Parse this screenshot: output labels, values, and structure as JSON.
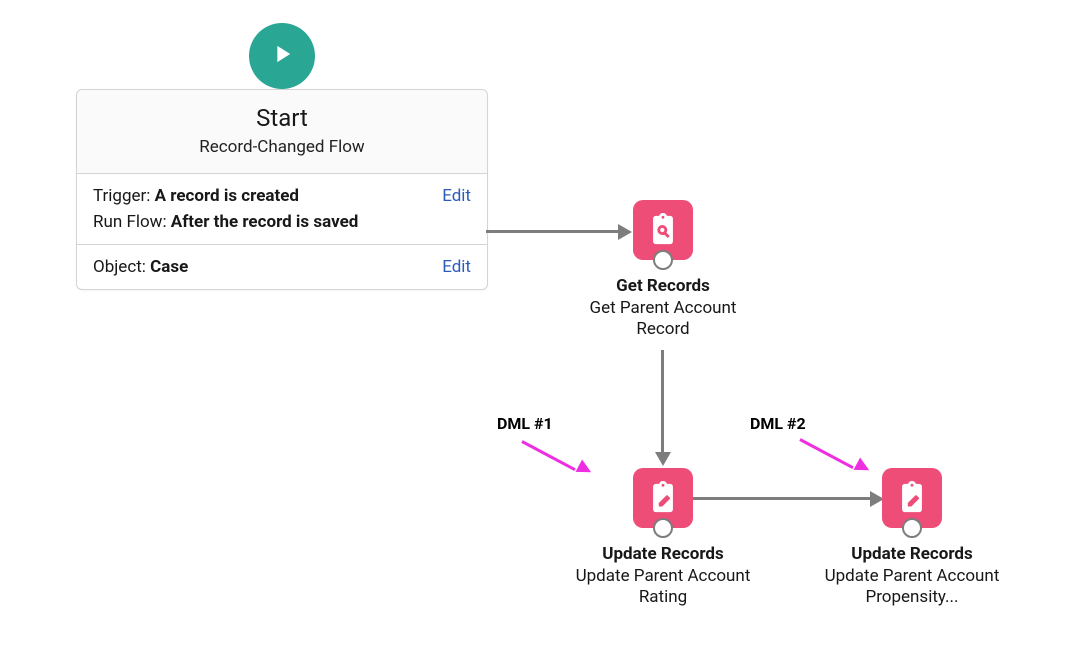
{
  "start": {
    "title": "Start",
    "subtitle": "Record-Changed Flow",
    "trigger_label": "Trigger: ",
    "trigger_value": "A record is created",
    "runflow_label": "Run Flow: ",
    "runflow_value": "After the record is saved",
    "object_label": "Object: ",
    "object_value": "Case",
    "edit_label": "Edit"
  },
  "nodes": {
    "get": {
      "title": "Get Records",
      "sub": "Get Parent Account Record",
      "icon": "clipboard-search-icon"
    },
    "upd1": {
      "title": "Update Records",
      "sub": "Update Parent Account Rating",
      "icon": "clipboard-edit-icon"
    },
    "upd2": {
      "title": "Update Records",
      "sub": "Update Parent Account Propensity...",
      "icon": "clipboard-edit-icon"
    }
  },
  "annotations": {
    "dml1": "DML #1",
    "dml2": "DML #2"
  },
  "colors": {
    "start_badge": "#2aa695",
    "node_pink": "#ee4d78",
    "connector": "#7d7d7d",
    "annotation": "#ee2fe1",
    "edit_link": "#2a5bb8"
  }
}
